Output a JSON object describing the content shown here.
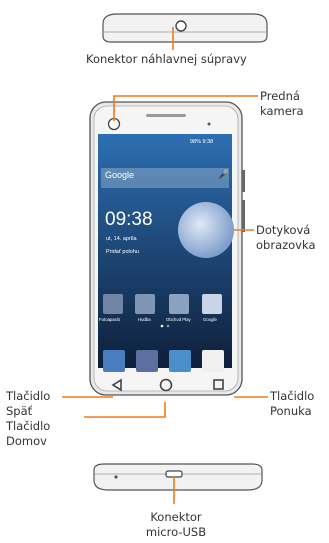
{
  "labels": {
    "headset": "Konektor náhlavnej súpravy",
    "front_camera": [
      "Predná",
      "kamera"
    ],
    "touchscreen": [
      "Dotyková",
      "obrazovka"
    ],
    "back_button": [
      "Tlačidlo",
      "Späť"
    ],
    "home_button": [
      "Tlačidlo",
      "Domov"
    ],
    "menu_button": [
      "Tlačidlo",
      "Ponuka"
    ],
    "usb": [
      "Konektor",
      "micro-USB"
    ]
  },
  "screen": {
    "status": "98%  9:38",
    "search_placeholder": "Google",
    "time": "09:38",
    "date": "ut, 14. apríla",
    "add_location": "Pridať polohu",
    "apps": [
      "Fotoaparát",
      "Hudba",
      "Obchod Play",
      "Google"
    ]
  },
  "colors": {
    "callout_line": "#f07b1a",
    "screen_top": "#2d6fb2",
    "screen_bottom": "#0e1f3a",
    "phone_body": "#e6e6e6"
  }
}
